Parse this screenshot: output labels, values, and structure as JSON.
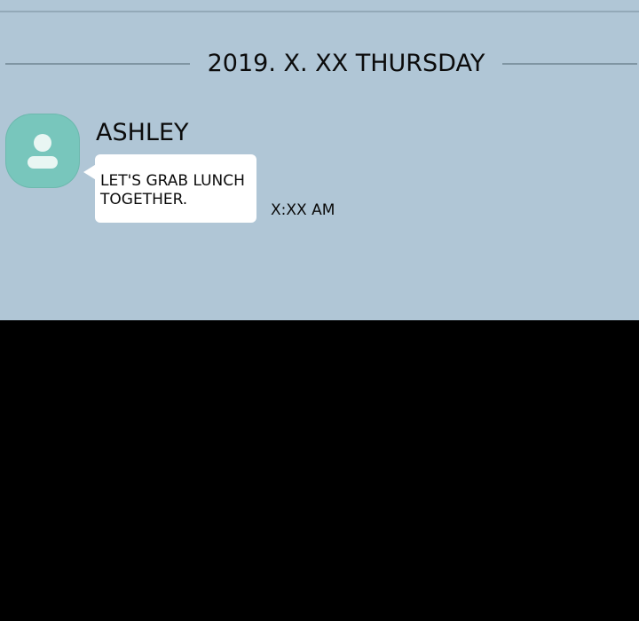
{
  "chat": {
    "date_separator": "2019. X. XX THURSDAY",
    "message": {
      "sender": "ASHLEY",
      "avatar_icon": "person-icon",
      "text": "LET'S GRAB LUNCH TOGETHER.",
      "time": "X:XX AM"
    }
  },
  "colors": {
    "chat_background": "#b0c6d6",
    "avatar": "#78c6bc",
    "bubble": "#ffffff",
    "lower_panel": "#000000"
  }
}
